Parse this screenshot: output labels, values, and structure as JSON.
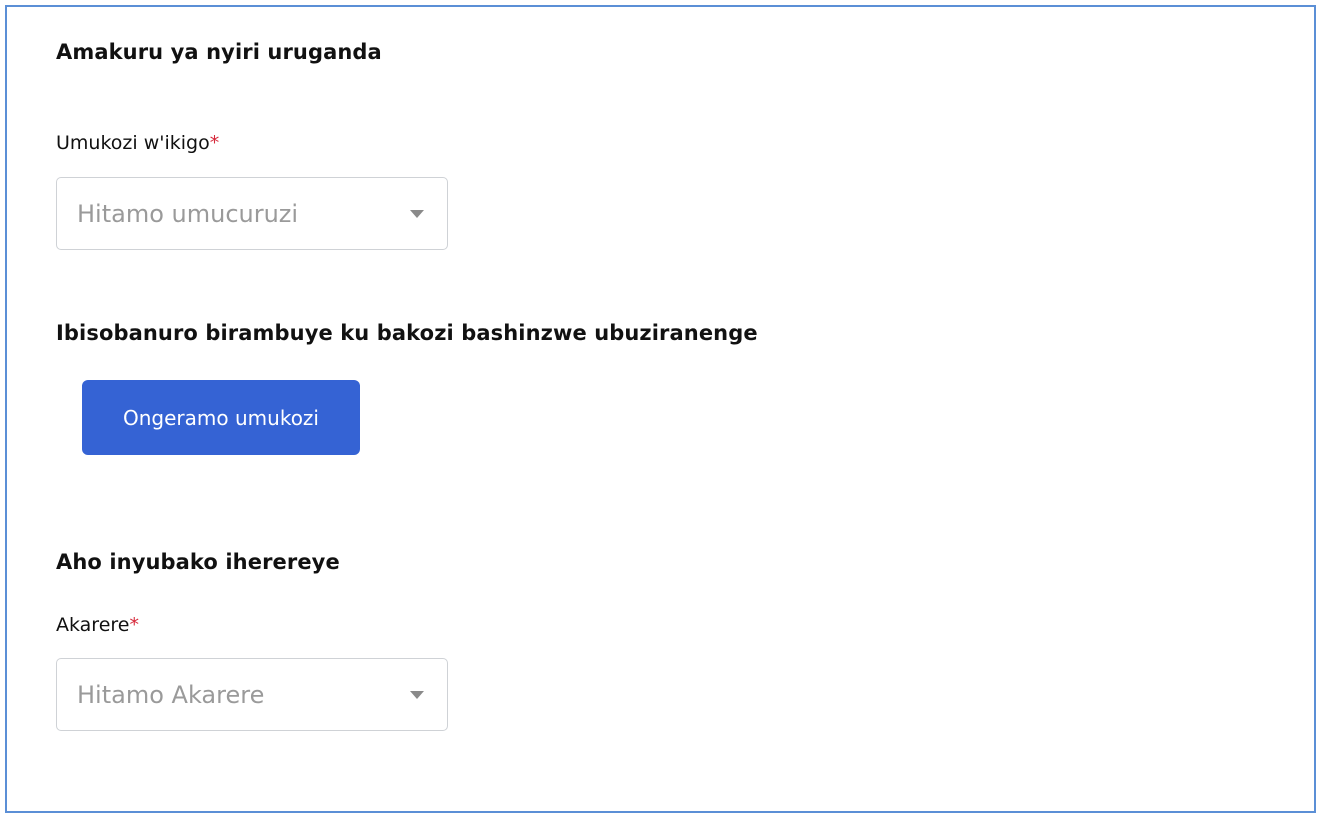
{
  "sections": {
    "owner": {
      "title": "Amakuru ya nyiri uruganda",
      "employee_field": {
        "label": "Umukozi w'ikigo",
        "required_mark": "*",
        "placeholder": "Hitamo umucuruzi"
      }
    },
    "safety": {
      "title": "Ibisobanuro birambuye ku bakozi bashinzwe ubuziranenge",
      "add_button_label": "Ongeramo umukozi"
    },
    "location": {
      "title": "Aho inyubako iherereye",
      "district_field": {
        "label": "Akarere",
        "required_mark": "*",
        "placeholder": "Hitamo Akarere"
      }
    }
  },
  "colors": {
    "frame_border": "#5b8fd6",
    "primary_button": "#3563d4",
    "required_mark": "#d6283a",
    "placeholder_text": "#9a9a9a"
  },
  "icons": {
    "dropdown": "caret-down-icon"
  }
}
